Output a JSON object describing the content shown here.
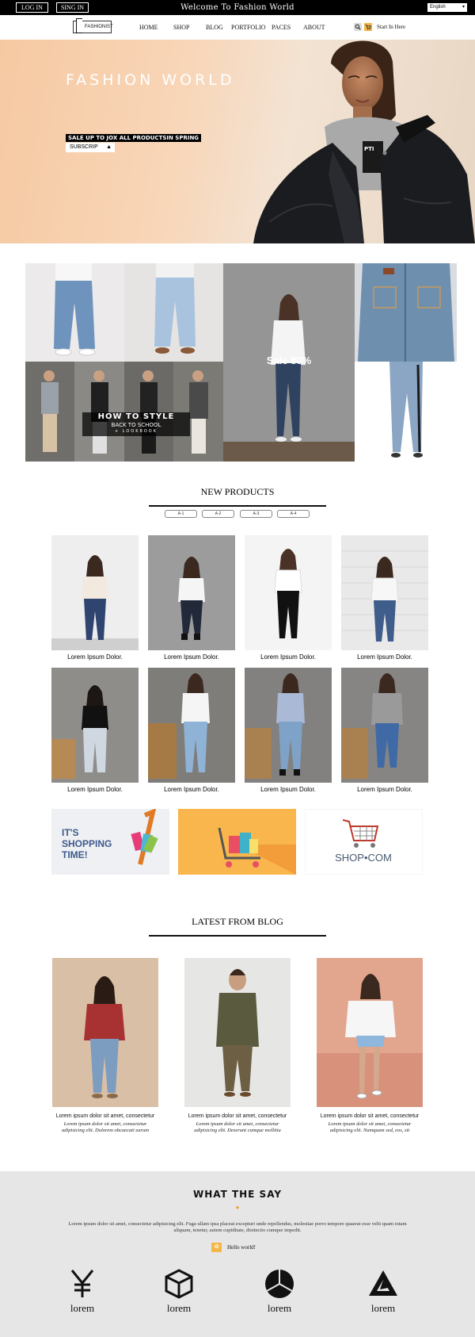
{
  "topbar": {
    "login": "LOG IN",
    "signin": "SING IN",
    "welcome": "Welcome To Fashion World",
    "language": "English"
  },
  "nav": {
    "logo_text": "FASHIONIST",
    "items": [
      "HOME",
      "SHOP",
      "BLOG",
      "PORTFOLIO",
      "PACES",
      "ABOUT"
    ],
    "search_icon": "search-icon",
    "cart_icon": "cart-icon",
    "start_label": "Start In Here"
  },
  "hero": {
    "title": "FASHION WORLD",
    "promo": "SALE UP TO JOX ALL PRODUCTSIN SPRING",
    "subscribe": "SUBSCRIP",
    "bell_icon": "bell-icon"
  },
  "collage": {
    "sale_label": "Sale 80%",
    "howto_title": "HOW TO STYLE",
    "howto_sub": "BACK TO SCHOOL",
    "howto_tag": "+ LOOKBOOK"
  },
  "new_products": {
    "title": "NEW PRODUCTS",
    "filters": [
      "A-1",
      "A-2",
      "A-3",
      "A-4"
    ],
    "products": [
      "Lorem Ipsum Dolor.",
      "Lorem Ipsum Dolor.",
      "Lorem Ipsum Dolor.",
      "Lorem Ipsum Dolor.",
      "Lorem Ipsum Dolor.",
      "Lorem Ipsum Dolor.",
      "Lorem Ipsum Dolor.",
      "Lorem Ipsum Dolor."
    ]
  },
  "banners": {
    "shopping_text": [
      "IT'S",
      "SHOPPING",
      "TIME!"
    ],
    "shopcom": "SHOP•COM"
  },
  "blog": {
    "title": "LATEST FROM BLOG",
    "posts": [
      {
        "title": "Lorem ipsum dolor sit amet, consectetur",
        "desc": "Lorem ipsum dolor sit amet, consectetur adipisicing elit. Dolorem obcaecati earum"
      },
      {
        "title": "Lorem ipsum dolor sit amet, consectetur",
        "desc": "Lorem ipsum dolor sit amet, consectetur adipisicing elit. Deserunt cumque mollitia"
      },
      {
        "title": "Lorem ipsum dolor sit amet, consectetur",
        "desc": "Lorem ipsum dolor sit amet, consectetur adipisicing elit. Numquam sed, eos, sit"
      }
    ]
  },
  "testimonials": {
    "title": "WHAT THE SAY",
    "text": "Lorem ipsum dolor sit amet, consectetur adipisicing elit. Fuga ullam ipsa placeat excepturi unde repellendus, molestiae porro tempore quaerat esse velit quam totam aliquam, tenetur, autem cupiditate, distinctio cumque impedit.",
    "hello": "Hello world!",
    "features": [
      {
        "icon": "yen-icon",
        "label": "lorem"
      },
      {
        "icon": "cube-icon",
        "label": "lorem"
      },
      {
        "icon": "aperture-icon",
        "label": "lorem"
      },
      {
        "icon": "triangle-logo-icon",
        "label": "lorem"
      }
    ]
  },
  "colors": {
    "topbar_bg": "#000000",
    "hero_peach": "#f6c9a2",
    "accent_orange": "#f5b64a",
    "footer_bg": "#e6e6e6"
  }
}
